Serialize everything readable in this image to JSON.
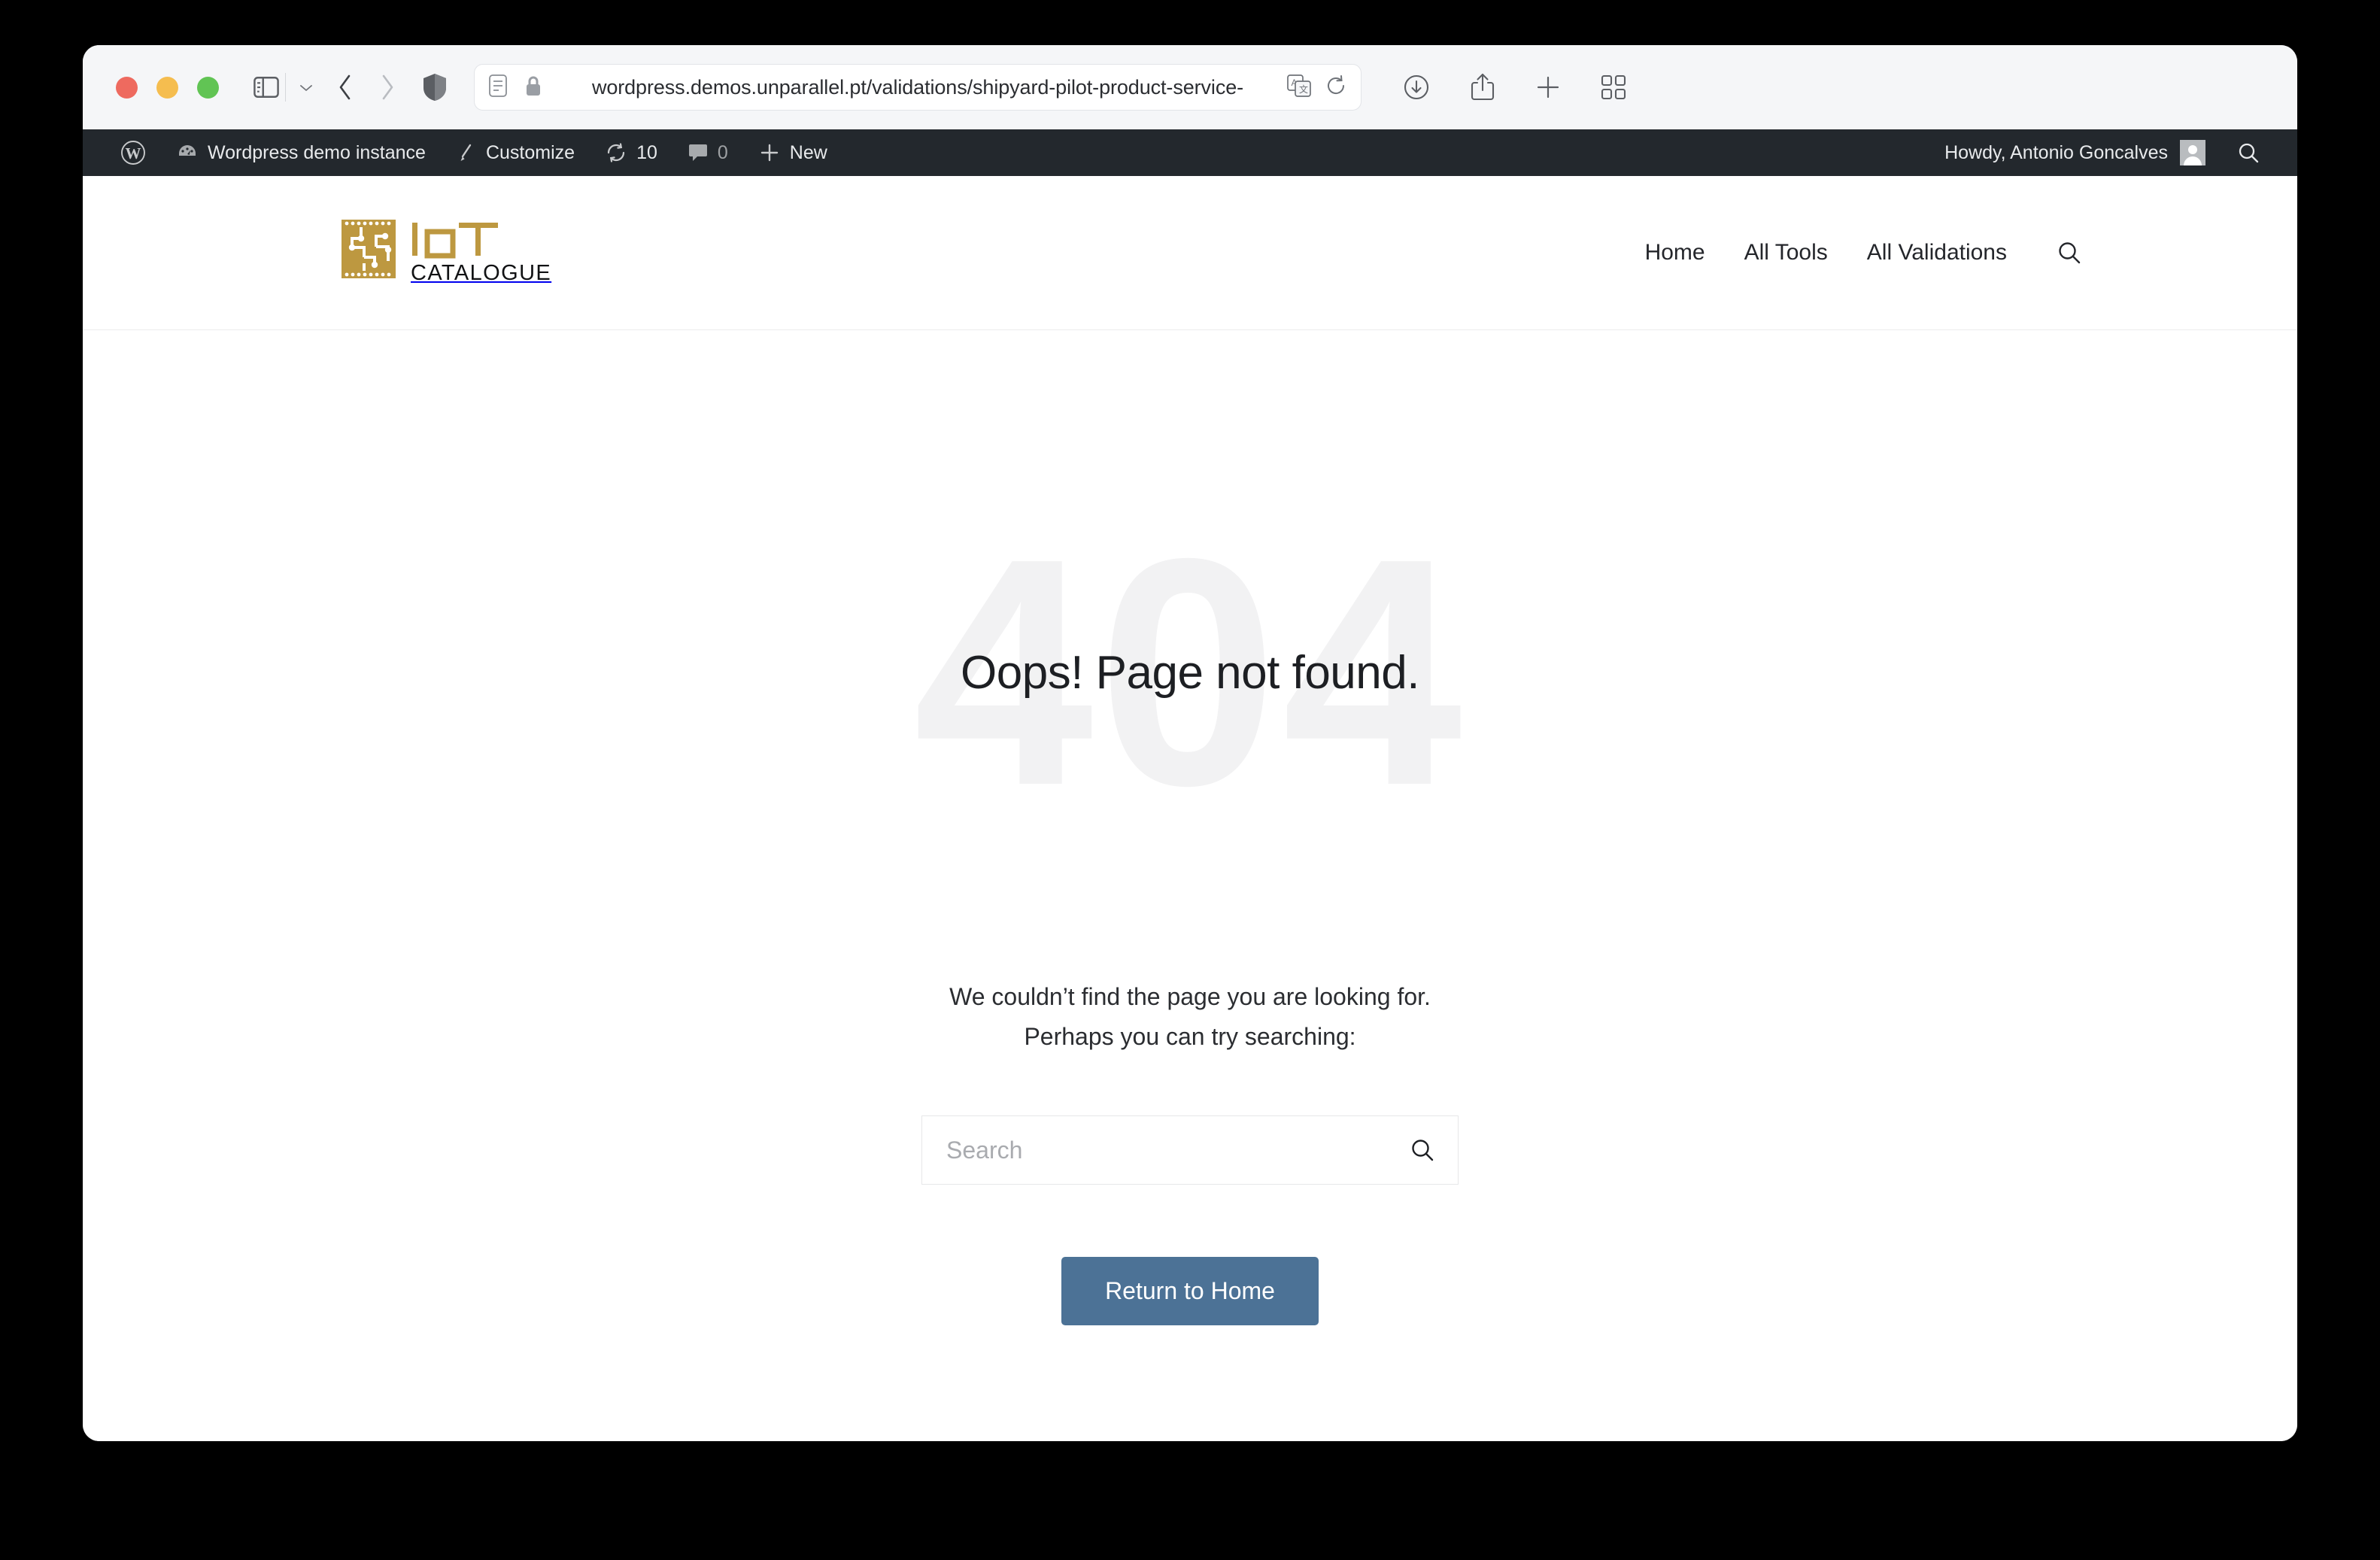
{
  "browser": {
    "url": "wordpress.demos.unparallel.pt/validations/shipyard-pilot-product-service-",
    "traffic_lights": [
      "close",
      "minimize",
      "maximize"
    ],
    "icons": {
      "sidebar": "sidebar-icon",
      "sidebar_chevron": "chevron-down-icon",
      "back": "back-arrow-icon",
      "forward": "forward-arrow-icon",
      "shield": "privacy-shield-icon",
      "reader": "reader-view-icon",
      "lock": "lock-icon",
      "translate": "translate-icon",
      "reload": "reload-icon",
      "downloads": "downloads-icon",
      "share": "share-icon",
      "new_tab": "plus-icon",
      "tab_overview": "tab-overview-icon"
    }
  },
  "admin_bar": {
    "wp_logo": "wordpress-logo-icon",
    "site_name": "Wordpress demo instance",
    "customize": "Customize",
    "updates_count": "10",
    "comments_count": "0",
    "new": "New",
    "howdy": "Howdy, Antonio Goncalves",
    "search": "search-icon"
  },
  "site_header": {
    "logo": {
      "mark": "iot-circuit-logo",
      "title": "IoT",
      "subtitle": "CATALOGUE",
      "gold": "#bd9840"
    },
    "nav": [
      {
        "label": "Home"
      },
      {
        "label": "All Tools"
      },
      {
        "label": "All Validations"
      }
    ],
    "search_icon": "search-icon"
  },
  "content": {
    "watermark": "404",
    "title": "Oops! Page not found.",
    "message_line1": "We couldn’t find the page you are looking for.",
    "message_line2": "Perhaps you can try searching:",
    "search_placeholder": "Search",
    "search_value": "",
    "search_icon": "search-icon",
    "home_button": "Return to Home",
    "home_button_color": "#4c7296"
  }
}
